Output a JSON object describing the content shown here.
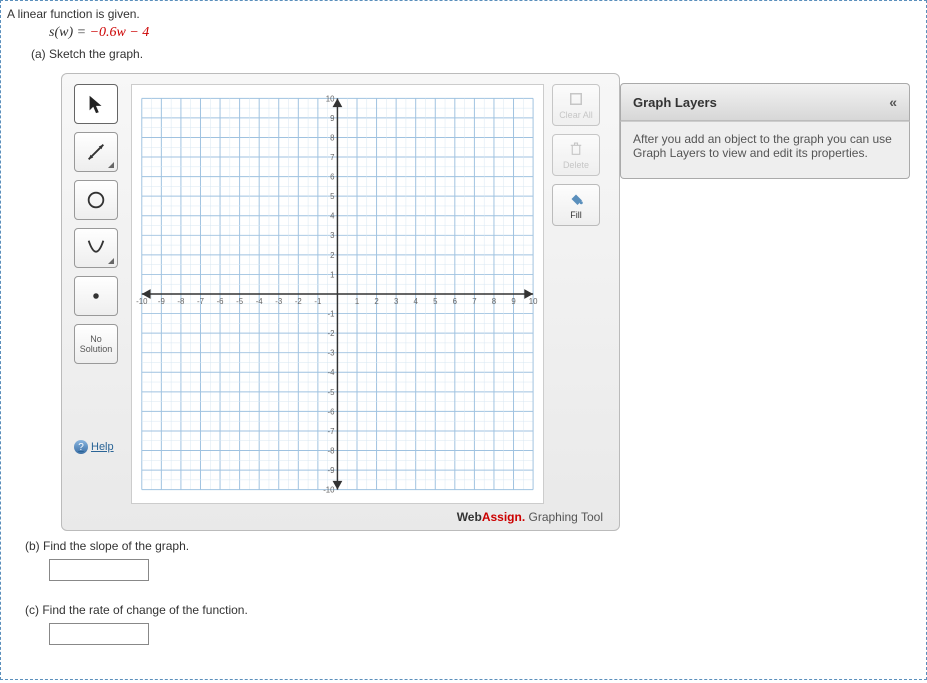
{
  "problem": {
    "intro": "A linear function is given.",
    "equation_lhs": "s(w) = ",
    "equation_rhs": "−0.6w − 4",
    "part_a": "(a) Sketch the graph.",
    "part_b": "(b) Find the slope of the graph.",
    "part_c": "(c) Find the rate of change of the function."
  },
  "tools": {
    "pointer": "pointer",
    "line": "line",
    "circle": "circle",
    "parabola": "parabola",
    "point": "point",
    "no_solution_line1": "No",
    "no_solution_line2": "Solution",
    "help": "Help"
  },
  "side_buttons": {
    "clear_all": "Clear All",
    "delete": "Delete",
    "fill": "Fill"
  },
  "graph": {
    "x_ticks": [
      "-10",
      "-9",
      "-8",
      "-7",
      "-6",
      "-5",
      "-4",
      "-3",
      "-2",
      "-1",
      "1",
      "2",
      "3",
      "4",
      "5",
      "6",
      "7",
      "8",
      "9",
      "10"
    ],
    "y_ticks": [
      "10",
      "9",
      "8",
      "7",
      "6",
      "5",
      "4",
      "3",
      "2",
      "1",
      "-1",
      "-2",
      "-3",
      "-4",
      "-5",
      "-6",
      "-7",
      "-8",
      "-9",
      "-10"
    ]
  },
  "layers": {
    "title": "Graph Layers",
    "collapse_glyph": "«",
    "body": "After you add an object to the graph you can use Graph Layers to view and edit its properties."
  },
  "brand": {
    "web": "Web",
    "assign": "Assign.",
    "tool": " Graphing Tool"
  },
  "answers": {
    "slope": "",
    "rate": ""
  }
}
